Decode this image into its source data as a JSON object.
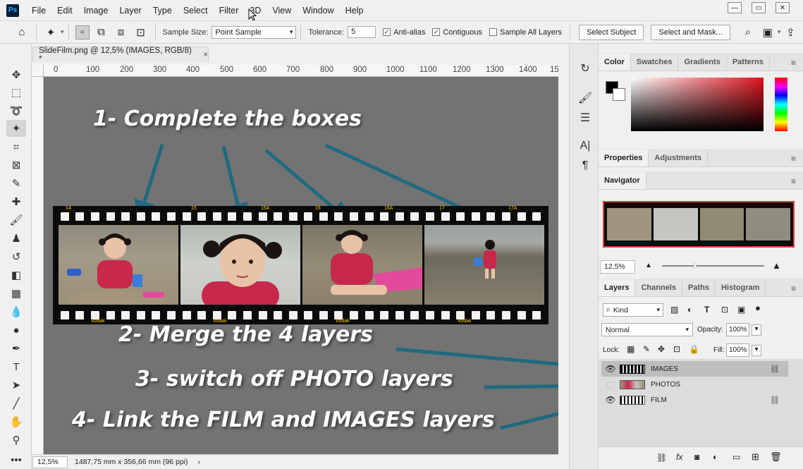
{
  "app": {
    "logo": "Ps",
    "menu": [
      "File",
      "Edit",
      "Image",
      "Layer",
      "Type",
      "Select",
      "Filter",
      "3D",
      "View",
      "Window",
      "Help"
    ],
    "window_controls": [
      "minimize-icon",
      "restore-icon",
      "close-icon"
    ]
  },
  "options": {
    "sample_size_label": "Sample Size:",
    "sample_size_value": "Point Sample",
    "tolerance_label": "Tolerance:",
    "tolerance_value": "5",
    "anti_alias": {
      "label": "Anti-alias",
      "checked": true
    },
    "contiguous": {
      "label": "Contiguous",
      "checked": true
    },
    "sample_all_layers": {
      "label": "Sample All Layers",
      "checked": false
    },
    "select_subject": "Select Subject",
    "select_and_mask": "Select and Mask..."
  },
  "document": {
    "tab_title": "SlideFilm.png @ 12,5% (IMAGES, RGB/8) *",
    "tab_close": "×",
    "ruler_ticks": [
      "0",
      "100",
      "200",
      "300",
      "400",
      "500",
      "600",
      "700",
      "800",
      "900",
      "1000",
      "1100",
      "1200",
      "1300",
      "1400",
      "15"
    ],
    "zoom": "12,5%",
    "doc_size": "1487,75 mm x 356,66 mm (96 ppi)",
    "status_arrow": "›"
  },
  "annotations": {
    "step1": "1- Complete the boxes",
    "step2": "2- Merge the 4 layers",
    "step3": "3- switch off PHOTO layers",
    "step4": "4- Link the FILM and IMAGES layers"
  },
  "film": {
    "frame_numbers_top": [
      "14",
      "15",
      "15A",
      "16",
      "16A",
      "17",
      "17A"
    ],
    "frame_numbers_bottom": [
      "kodak",
      "kodak",
      "kodak",
      "kodak"
    ]
  },
  "color_panel": {
    "tabs": [
      "Color",
      "Swatches",
      "Gradients",
      "Patterns"
    ],
    "foreground": "#000000",
    "background": "#ffffff"
  },
  "properties_panel": {
    "tabs": [
      "Properties",
      "Adjustments"
    ]
  },
  "navigator_panel": {
    "tab": "Navigator",
    "zoom": "12,5%"
  },
  "layers_panel": {
    "tabs": [
      "Layers",
      "Channels",
      "Paths",
      "Histogram"
    ],
    "filter_kind": "Kind",
    "blend_mode": "Normal",
    "opacity_label": "Opacity:",
    "opacity_value": "100%",
    "lock_label": "Lock:",
    "fill_label": "Fill:",
    "fill_value": "100%",
    "layers": [
      {
        "name": "IMAGES",
        "visible": true,
        "linked": true,
        "selected": true
      },
      {
        "name": "PHOTOS",
        "visible": false,
        "linked": false,
        "selected": false
      },
      {
        "name": "FILM",
        "visible": true,
        "linked": true,
        "selected": false
      }
    ]
  }
}
